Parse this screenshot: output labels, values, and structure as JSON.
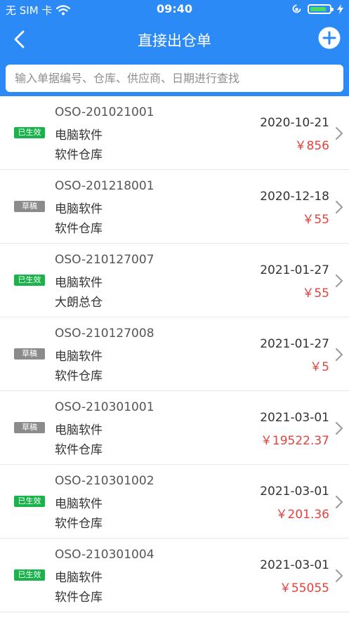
{
  "status_bar": {
    "carrier": "无 SIM 卡",
    "time": "09:40"
  },
  "nav": {
    "title": "直接出仓单"
  },
  "search": {
    "placeholder": "输入单据编号、仓库、供应商、日期进行查找"
  },
  "orders": [
    {
      "status": "已生效",
      "status_type": "active",
      "code": "OSO-201021001",
      "item": "电脑软件",
      "warehouse": "软件仓库",
      "date": "2020-10-21",
      "amount": "￥856"
    },
    {
      "status": "草稿",
      "status_type": "draft",
      "code": "OSO-201218001",
      "item": "电脑软件",
      "warehouse": "软件仓库",
      "date": "2020-12-18",
      "amount": "￥55"
    },
    {
      "status": "已生效",
      "status_type": "active",
      "code": "OSO-210127007",
      "item": "电脑软件",
      "warehouse": "大朗总仓",
      "date": "2021-01-27",
      "amount": "￥55"
    },
    {
      "status": "草稿",
      "status_type": "draft",
      "code": "OSO-210127008",
      "item": "电脑软件",
      "warehouse": "软件仓库",
      "date": "2021-01-27",
      "amount": "￥5"
    },
    {
      "status": "草稿",
      "status_type": "draft",
      "code": "OSO-210301001",
      "item": "电脑软件",
      "warehouse": "软件仓库",
      "date": "2021-03-01",
      "amount": "￥19522.37"
    },
    {
      "status": "已生效",
      "status_type": "active",
      "code": "OSO-210301002",
      "item": "电脑软件",
      "warehouse": "软件仓库",
      "date": "2021-03-01",
      "amount": "￥201.36"
    },
    {
      "status": "已生效",
      "status_type": "active",
      "code": "OSO-210301004",
      "item": "电脑软件",
      "warehouse": "软件仓库",
      "date": "2021-03-01",
      "amount": "￥55055"
    }
  ],
  "colors": {
    "header": "#2b8af5",
    "active_badge": "#19b24b",
    "draft_badge": "#8b8b8b",
    "amount": "#e8403b",
    "battery": "#4cd964"
  },
  "battery_level": 0.85
}
